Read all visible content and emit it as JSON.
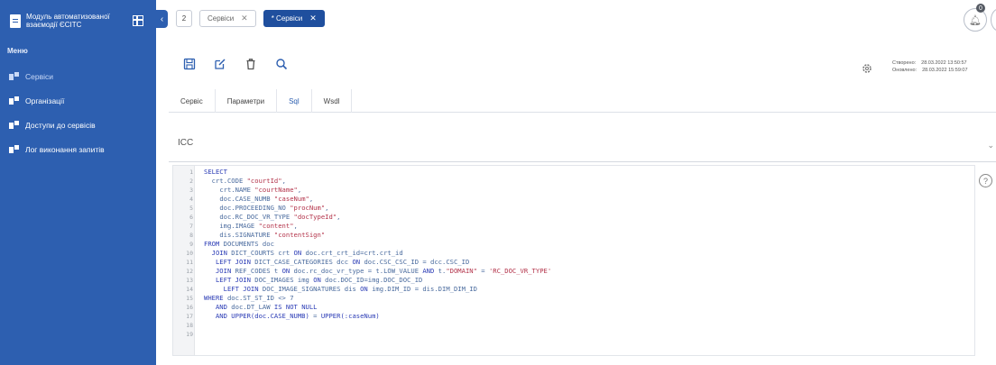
{
  "sidebar": {
    "title": "Модуль автоматизованої взаємодії ЄСІТС",
    "menu_label": "Меню",
    "items": [
      {
        "label": "Сервіси",
        "active": true
      },
      {
        "label": "Організації",
        "active": false
      },
      {
        "label": "Доступи до сервісів",
        "active": false
      },
      {
        "label": "Лог виконання запитів",
        "active": false
      }
    ]
  },
  "tabs": {
    "count": "2",
    "items": [
      {
        "label": "Сервіси",
        "active": false
      },
      {
        "label": "* Сервіси",
        "active": true
      }
    ]
  },
  "notifications": {
    "badge": "0"
  },
  "toolbar": {
    "icons": [
      "save-icon",
      "edit-icon",
      "delete-icon",
      "search-icon"
    ]
  },
  "meta": {
    "created_label": "Створено:",
    "created_value": "28.03.2022 13:50:57",
    "updated_label": "Оновлено:",
    "updated_value": "28.03.2022 15:59:07"
  },
  "subtabs": [
    {
      "label": "Сервіс",
      "active": false
    },
    {
      "label": "Параметри",
      "active": false
    },
    {
      "label": "Sql",
      "active": true
    },
    {
      "label": "Wsdl",
      "active": false
    }
  ],
  "field": {
    "value": "ICC"
  },
  "editor": {
    "line_numbers": [
      "1",
      "2",
      "3",
      "4",
      "5",
      "6",
      "7",
      "8",
      "9",
      "10",
      "11",
      "12",
      "13",
      "14",
      "15",
      "16",
      "17",
      "18",
      "19"
    ],
    "lines": [
      "SELECT",
      "  crt.CODE \"courtId\",",
      "    crt.NAME \"courtName\",",
      "    doc.CASE_NUMB \"caseNum\",",
      "    doc.PROCEEDING_NO \"procNum\",",
      "    doc.RC_DOC_VR_TYPE \"docTypeId\",",
      "    img.IMAGE \"content\",",
      "    dis.SIGNATURE \"contentSign\"",
      "FROM DOCUMENTS doc",
      "  JOIN DICT_COURTS crt ON doc.crt_crt_id=crt.crt_id",
      "   LEFT JOIN DICT_CASE_CATEGORIES dcc ON doc.CSC_CSC_ID = dcc.CSC_ID",
      "   JOIN REF_CODES t ON doc.rc_doc_vr_type = t.LOW_VALUE AND t.\"DOMAIN\" = 'RC_DOC_VR_TYPE'",
      "   LEFT JOIN DOC_IMAGES img ON doc.DOC_ID=img.DOC_DOC_ID",
      "     LEFT JOIN DOC_IMAGE_SIGNATURES dis ON img.DIM_ID = dis.DIM_DIM_ID",
      "WHERE doc.ST_ST_ID <> 7",
      "   AND doc.DT_LAW IS NOT NULL",
      "   AND UPPER(doc.CASE_NUMB) = UPPER(:caseNum)",
      "",
      ""
    ]
  }
}
